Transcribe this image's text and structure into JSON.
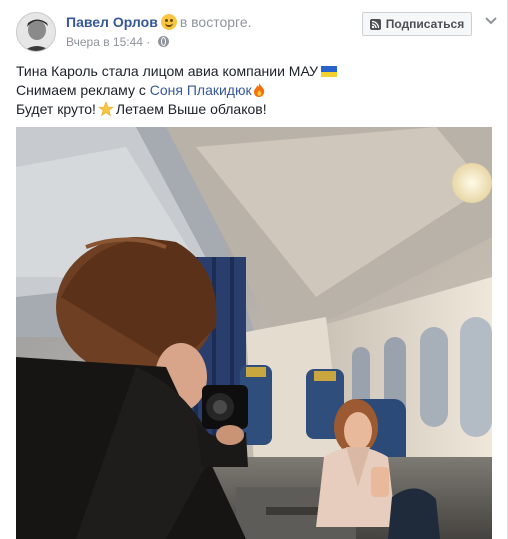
{
  "post": {
    "author": "Павел Орлов",
    "feeling": "в восторге.",
    "timestamp": "Вчера в 15:44",
    "separator": "·",
    "subscribe_label": "Подписаться",
    "lines": {
      "line1": "Тина Кароль стала лицом авиа компании МАУ",
      "line2_prefix": "Снимаем рекламу с",
      "mention": "Соня Плакидюк",
      "line3_prefix": "Будет круто!",
      "line3_suffix": "Летаем Выше облаков!"
    }
  },
  "icons": {
    "feeling_emoji": "laughing-face-icon",
    "privacy": "globe-icon",
    "subscribe": "rss-icon",
    "menu": "chevron-down-icon",
    "flag": "ukraine-flag-icon",
    "fire": "fire-icon",
    "star": "star-icon"
  },
  "colors": {
    "link": "#365899",
    "muted": "#90949c",
    "text": "#1d2129"
  }
}
